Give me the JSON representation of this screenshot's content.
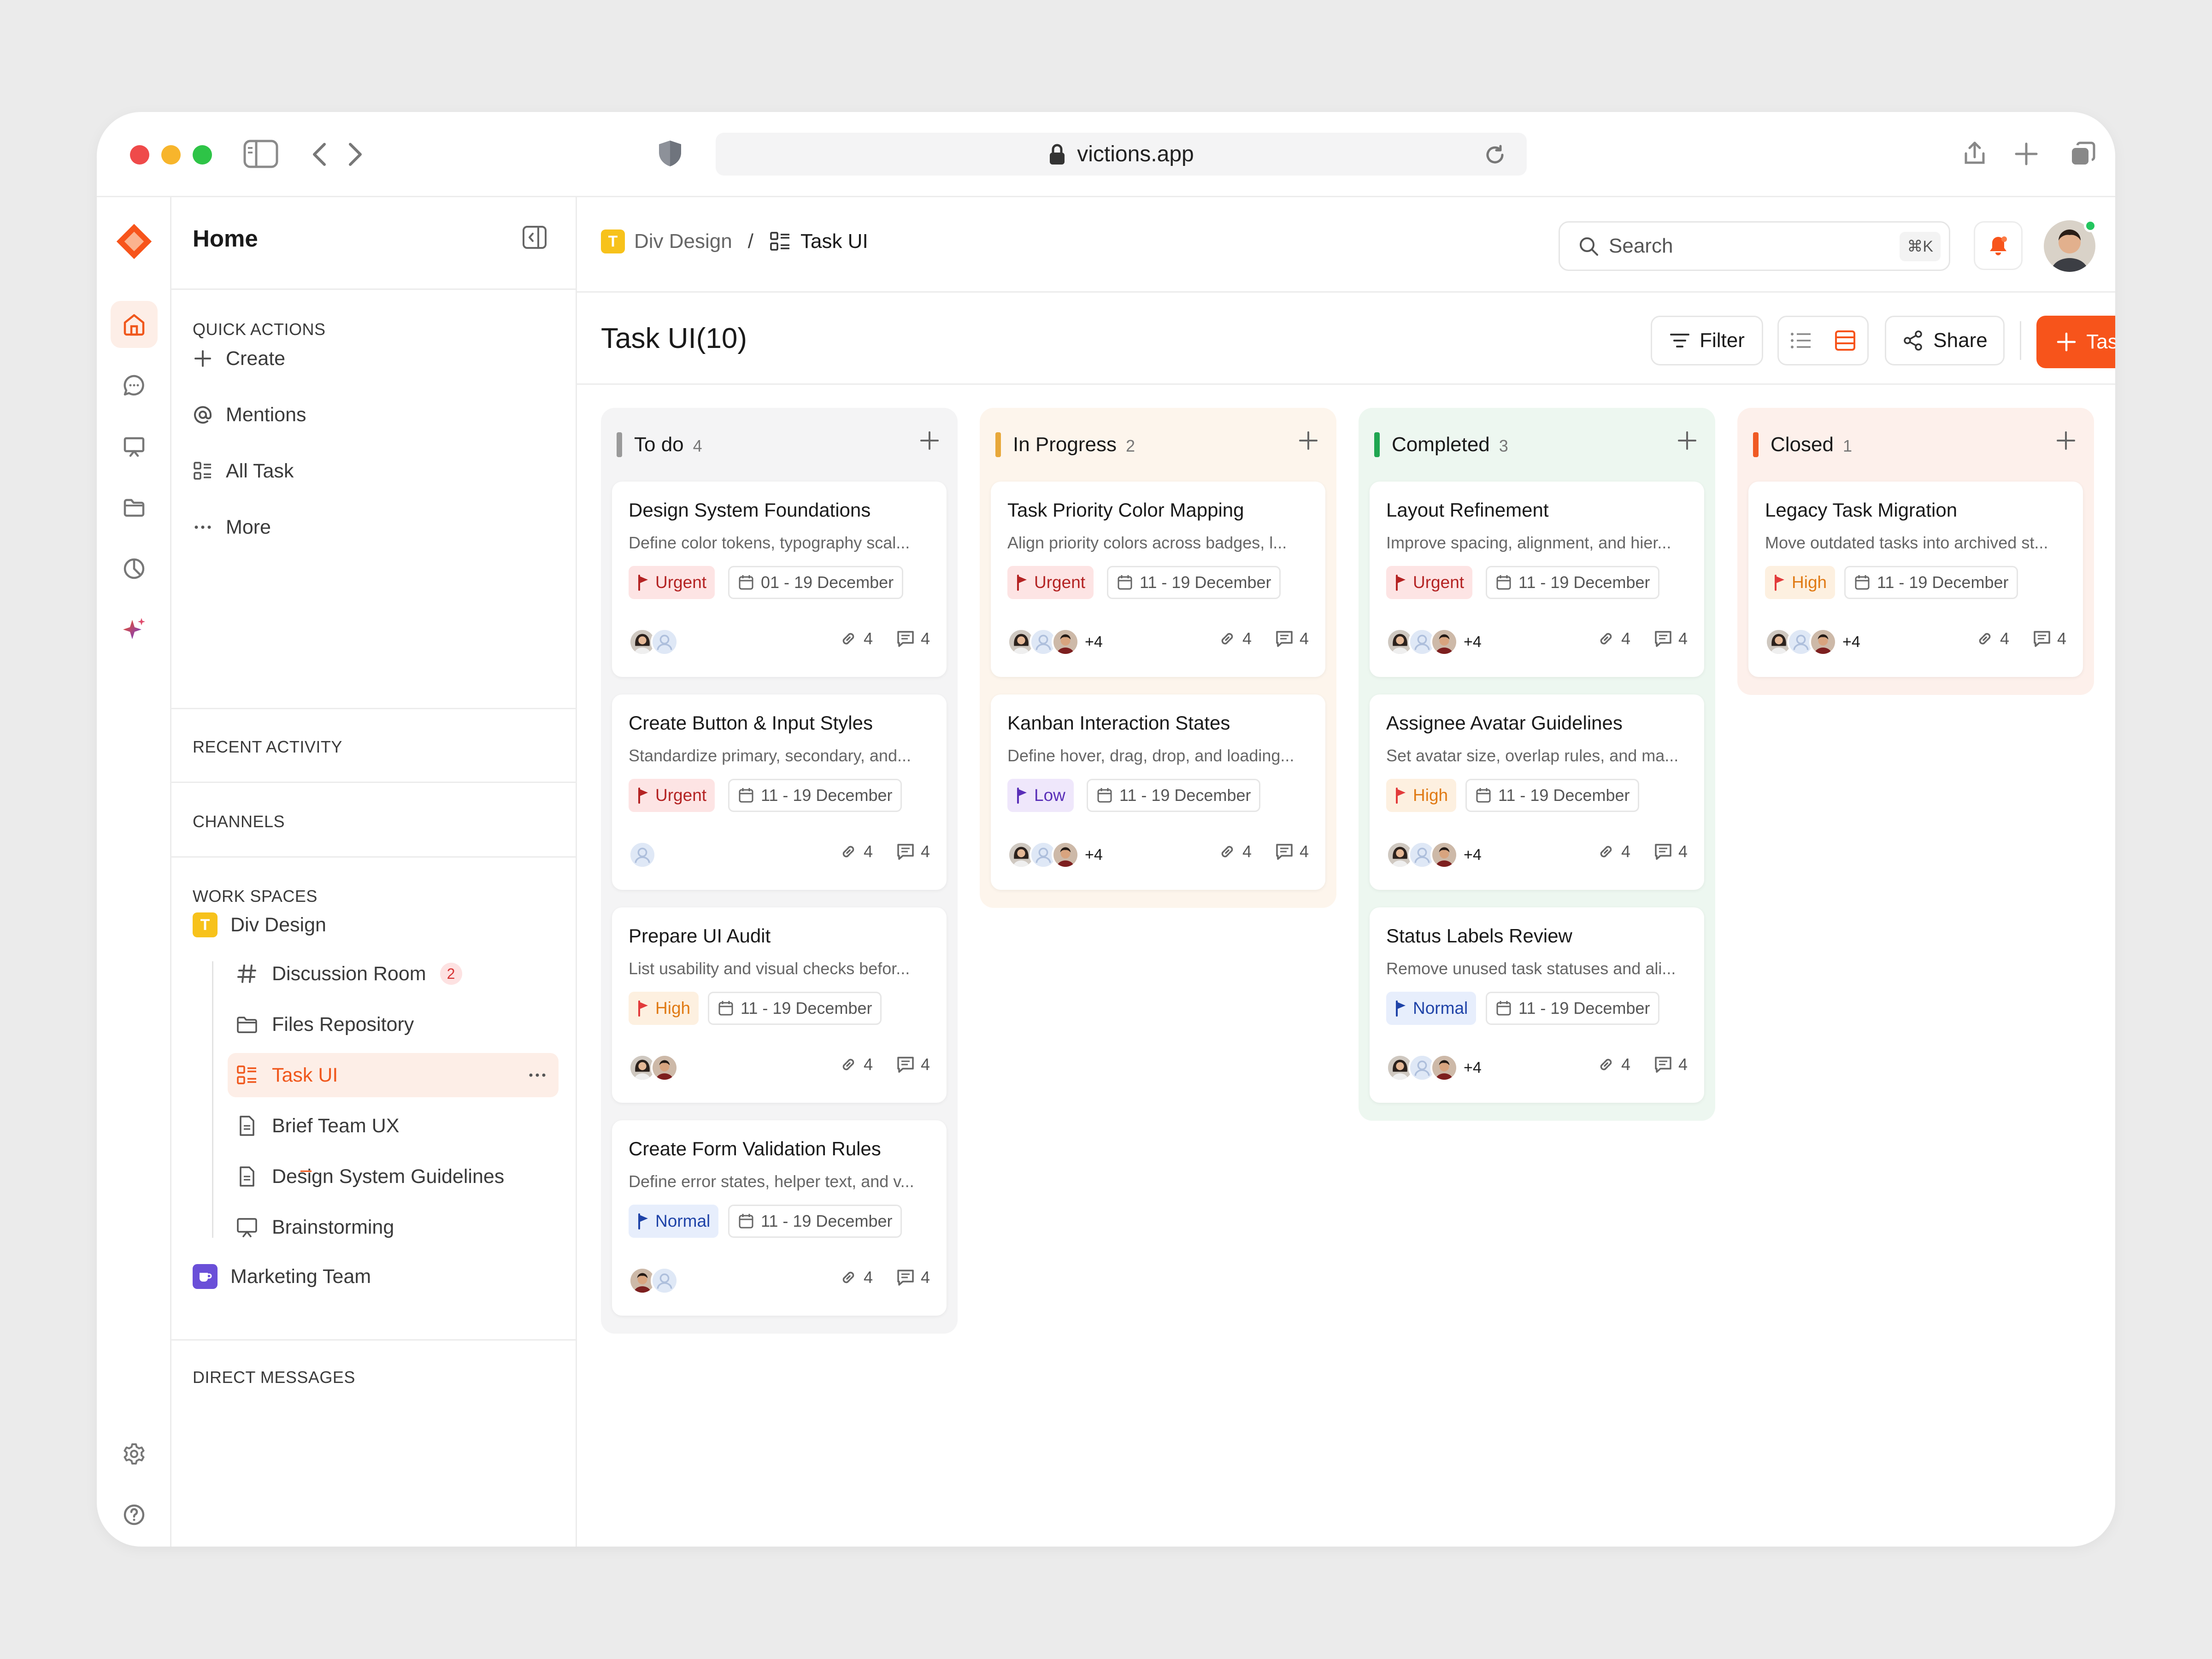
{
  "browser": {
    "url": "victions.app"
  },
  "colors": {
    "accent": "#f7541b",
    "todo": "#9a9a9a",
    "in_progress": "#e8a83a",
    "completed": "#1fa651",
    "closed": "#f05a24"
  },
  "sidebar": {
    "title": "Home",
    "quick_actions_label": "QUICK ACTIONS",
    "quick_actions": [
      {
        "label": "Create",
        "icon": "plus-icon"
      },
      {
        "label": "Mentions",
        "icon": "at-icon"
      },
      {
        "label": "All Task",
        "icon": "task-list-icon"
      },
      {
        "label": "More",
        "icon": "more-icon"
      }
    ],
    "recent_activity_label": "RECENT ACTIVITY",
    "channels_label": "CHANNELS",
    "workspaces_label": "WORK SPACES",
    "workspace_1": {
      "letter": "T",
      "name": "Div Design"
    },
    "sub_items": [
      {
        "label": "Discussion Room",
        "badge": "2"
      },
      {
        "label": "Files Repository"
      },
      {
        "label": "Task UI"
      },
      {
        "label": "Brief Team UX"
      },
      {
        "label": "Design System Guidelines"
      },
      {
        "label": "Brainstorming"
      }
    ],
    "workspace_2": {
      "name": "Marketing Team"
    },
    "direct_messages_label": "DIRECT MESSAGES"
  },
  "header": {
    "breadcrumb_root_letter": "T",
    "breadcrumb_root": "Div Design",
    "breadcrumb_sep": "/",
    "breadcrumb_current": "Task UI",
    "search_placeholder": "Search",
    "search_shortcut": "⌘K"
  },
  "toolbar": {
    "page_title": "Task UI(10)",
    "filter_label": "Filter",
    "share_label": "Share",
    "task_label": "Task"
  },
  "columns": [
    {
      "name": "To do",
      "count": "4",
      "cards": [
        {
          "title": "Design System Foundations",
          "desc": "Define color tokens, typography scal...",
          "priority": "Urgent",
          "date": "01 - 19 December",
          "links": "4",
          "comments": "4",
          "avatars": [
            "female",
            "placeholder"
          ],
          "more": ""
        },
        {
          "title": "Create Button & Input Styles",
          "desc": "Standardize primary, secondary, and...",
          "priority": "Urgent",
          "date": "11 - 19 December",
          "links": "4",
          "comments": "4",
          "avatars": [
            "placeholder"
          ],
          "more": ""
        },
        {
          "title": "Prepare UI Audit",
          "desc": "List usability and visual checks befor...",
          "priority": "High",
          "date": "11 - 19 December",
          "links": "4",
          "comments": "4",
          "avatars": [
            "female",
            "male"
          ],
          "more": ""
        },
        {
          "title": "Create Form Validation Rules",
          "desc": "Define error states, helper text, and v...",
          "priority": "Normal",
          "date": "11 - 19 December",
          "links": "4",
          "comments": "4",
          "avatars": [
            "male",
            "placeholder"
          ],
          "more": ""
        }
      ]
    },
    {
      "name": "In Progress",
      "count": "2",
      "cards": [
        {
          "title": "Task Priority Color Mapping",
          "desc": "Align priority colors across badges, l...",
          "priority": "Urgent",
          "date": "11 - 19 December",
          "links": "4",
          "comments": "4",
          "avatars": [
            "female",
            "placeholder",
            "male"
          ],
          "more": "+4"
        },
        {
          "title": "Kanban Interaction States",
          "desc": "Define hover, drag, drop, and loading...",
          "priority": "Low",
          "date": "11 - 19 December",
          "links": "4",
          "comments": "4",
          "avatars": [
            "female",
            "placeholder",
            "male"
          ],
          "more": "+4"
        }
      ]
    },
    {
      "name": "Completed",
      "count": "3",
      "cards": [
        {
          "title": "Layout Refinement",
          "desc": "Improve spacing, alignment, and hier...",
          "priority": "Urgent",
          "date": "11 - 19 December",
          "links": "4",
          "comments": "4",
          "avatars": [
            "female",
            "placeholder",
            "male"
          ],
          "more": "+4"
        },
        {
          "title": "Assignee Avatar Guidelines",
          "desc": "Set avatar size, overlap rules, and ma...",
          "priority": "High",
          "date": "11 - 19 December",
          "links": "4",
          "comments": "4",
          "avatars": [
            "female",
            "placeholder",
            "male"
          ],
          "more": "+4"
        },
        {
          "title": "Status Labels Review",
          "desc": "Remove unused task statuses and ali...",
          "priority": "Normal",
          "date": "11 - 19 December",
          "links": "4",
          "comments": "4",
          "avatars": [
            "female",
            "placeholder",
            "male"
          ],
          "more": "+4"
        }
      ]
    },
    {
      "name": "Closed",
      "count": "1",
      "cards": [
        {
          "title": "Legacy Task Migration",
          "desc": "Move outdated tasks into archived st...",
          "priority": "High",
          "date": "11 - 19 December",
          "links": "4",
          "comments": "4",
          "avatars": [
            "female",
            "placeholder",
            "male"
          ],
          "more": "+4"
        }
      ]
    }
  ]
}
